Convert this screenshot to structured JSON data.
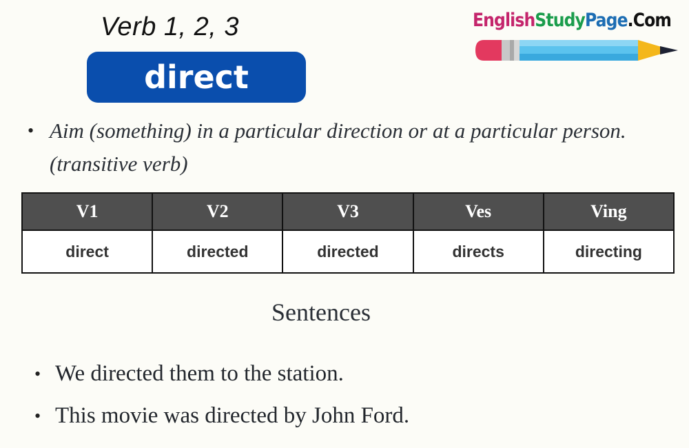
{
  "header": {
    "subtitle": "Verb 1, 2, 3",
    "verb": "direct",
    "badge_color": "#0a4ead"
  },
  "logo": {
    "part1": "English",
    "part2": "Study",
    "part3": "Page",
    "part4": ".Com",
    "icon": "pencil-icon"
  },
  "definition": {
    "bullet": "•",
    "text": "Aim (something) in a particular direction or at a particular person. (transitive verb)"
  },
  "forms_table": {
    "headers": [
      "V1",
      "V2",
      "V3",
      "Ves",
      "Ving"
    ],
    "values": [
      "direct",
      "directed",
      "directed",
      "directs",
      "directing"
    ],
    "header_color": "#4f4f4f"
  },
  "sentences": {
    "title": "Sentences",
    "bullet": "•",
    "items": [
      "We directed them to the station.",
      "This movie was directed by John Ford."
    ]
  }
}
